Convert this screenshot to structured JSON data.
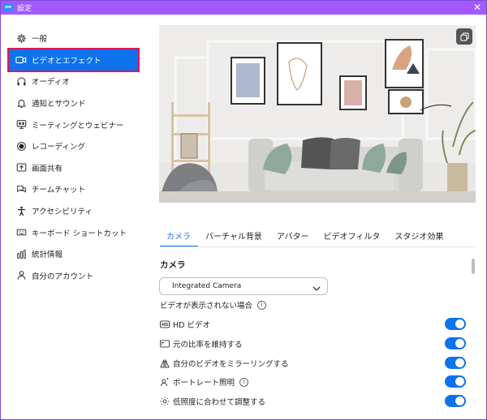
{
  "window": {
    "title": "設定",
    "app_icon_text": "zm",
    "close_glyph": "✕"
  },
  "sidebar": {
    "items": [
      {
        "label": "一般",
        "icon": "gear-icon"
      },
      {
        "label": "ビデオとエフェクト",
        "icon": "video-camera-icon",
        "active": true
      },
      {
        "label": "オーディオ",
        "icon": "headphones-icon"
      },
      {
        "label": "通知とサウンド",
        "icon": "bell-icon"
      },
      {
        "label": "ミーティングとウェビナー",
        "icon": "monitor-icon"
      },
      {
        "label": "レコーディング",
        "icon": "record-icon"
      },
      {
        "label": "画面共有",
        "icon": "share-screen-icon"
      },
      {
        "label": "チームチャット",
        "icon": "chat-icon"
      },
      {
        "label": "アクセシビリティ",
        "icon": "accessibility-icon"
      },
      {
        "label": "キーボード ショートカット",
        "icon": "keyboard-icon"
      },
      {
        "label": "統計情報",
        "icon": "stats-icon"
      },
      {
        "label": "自分のアカウント",
        "icon": "user-icon"
      }
    ]
  },
  "tabs": [
    {
      "label": "カメラ",
      "active": true
    },
    {
      "label": "バーチャル背景"
    },
    {
      "label": "アバター"
    },
    {
      "label": "ビデオフィルタ"
    },
    {
      "label": "スタジオ効果"
    }
  ],
  "camera": {
    "section_title": "カメラ",
    "selected_camera": "Integrated Camera",
    "no_video_label": "ビデオが表示されない場合",
    "options": [
      {
        "label": "HD ビデオ",
        "icon": "hd-icon",
        "enabled": true
      },
      {
        "label": "元の比率を維持する",
        "icon": "aspect-ratio-icon",
        "enabled": true
      },
      {
        "label": "自分のビデオをミラーリングする",
        "icon": "mirror-icon",
        "enabled": true
      },
      {
        "label": "ポートレート照明",
        "icon": "portrait-light-icon",
        "enabled": true,
        "info": true
      },
      {
        "label": "低照度に合わせて調整する",
        "icon": "brightness-icon",
        "enabled": true
      }
    ]
  },
  "colors": {
    "accent": "#0e72ed",
    "titlebar": "#a259ff",
    "highlight": "#e0195c"
  }
}
